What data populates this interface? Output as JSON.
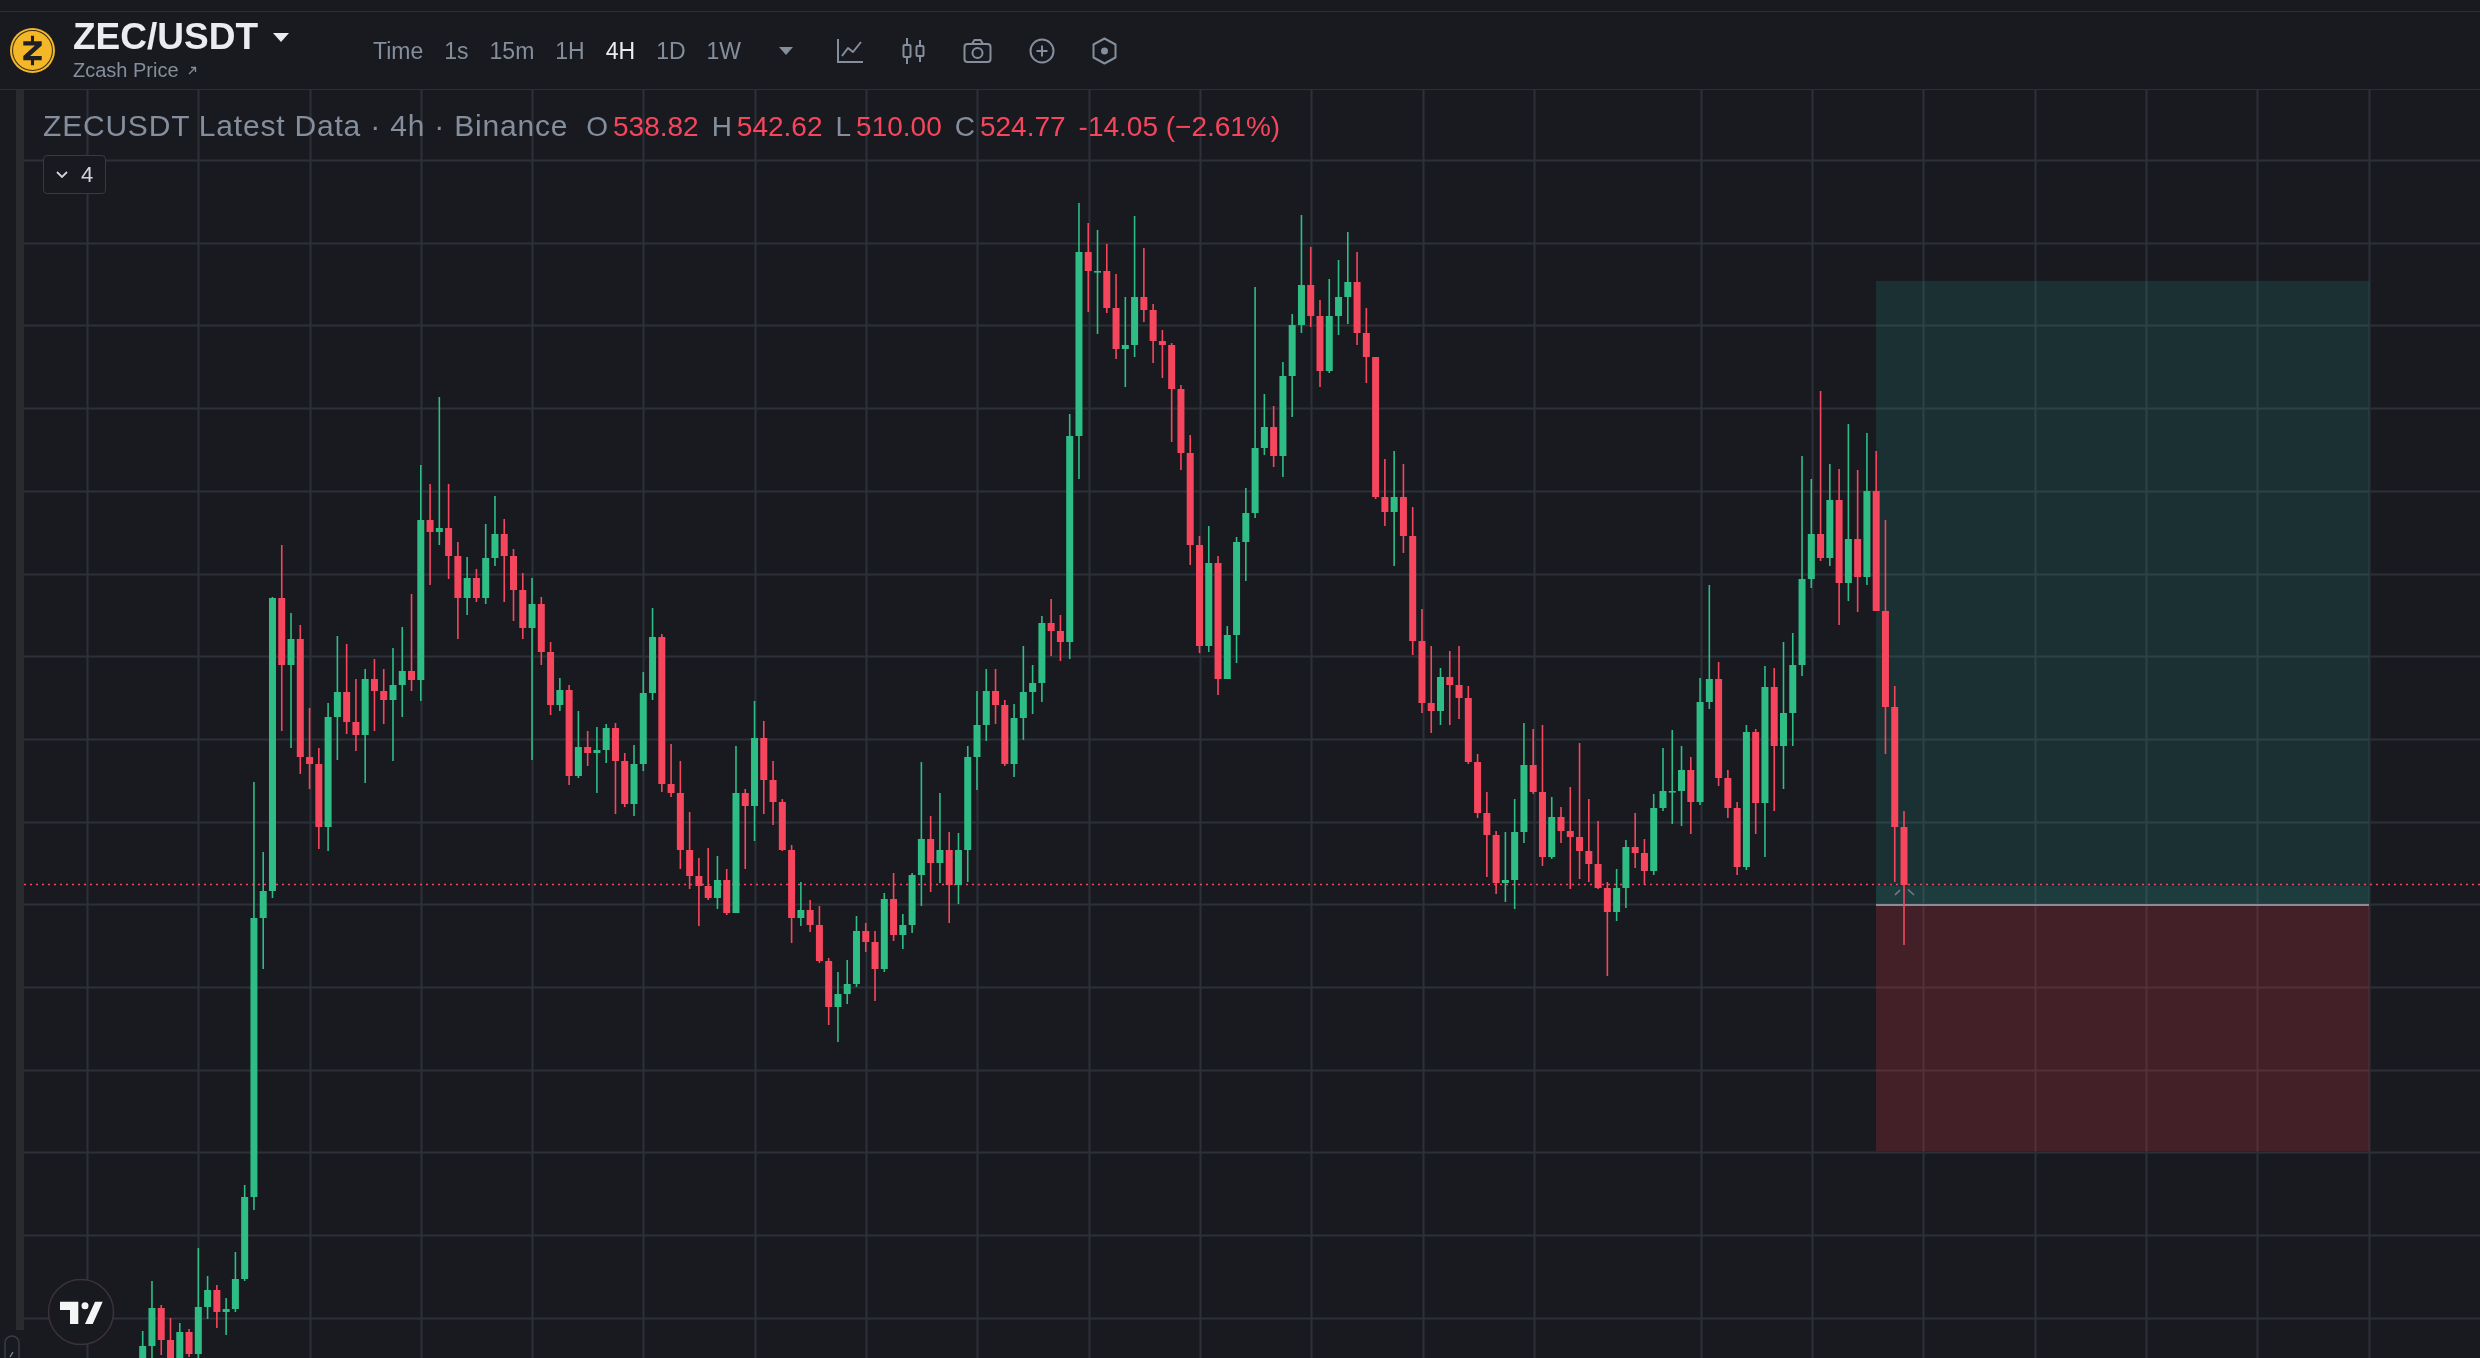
{
  "symbol": {
    "name": "ZEC/USDT",
    "subtitle": "Zcash Price"
  },
  "intervals": [
    {
      "label": "Time",
      "selected": false
    },
    {
      "label": "1s",
      "selected": false
    },
    {
      "label": "15m",
      "selected": false
    },
    {
      "label": "1H",
      "selected": false
    },
    {
      "label": "4H",
      "selected": true
    },
    {
      "label": "1D",
      "selected": false
    },
    {
      "label": "1W",
      "selected": false
    }
  ],
  "legend": {
    "title": "ZECUSDT Latest Data · 4h · Binance",
    "falling": true,
    "ohlc": [
      {
        "label": "O",
        "value": "538.82"
      },
      {
        "label": "H",
        "value": "542.62"
      },
      {
        "label": "L",
        "value": "510.00"
      },
      {
        "label": "C",
        "value": "524.77"
      }
    ],
    "change": "-14.05 (−2.61%)"
  },
  "indicators_toggle": {
    "count": "4"
  }
}
